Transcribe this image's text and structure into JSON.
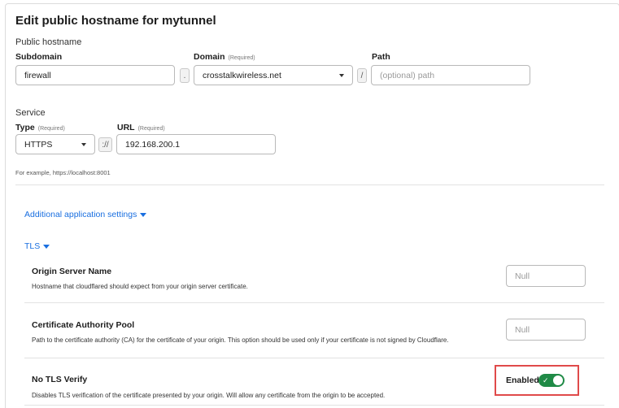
{
  "page_title": "Edit public hostname for mytunnel",
  "public_hostname": {
    "section_label": "Public hostname",
    "subdomain": {
      "label": "Subdomain",
      "value": "firewall"
    },
    "dot_separator": ".",
    "domain": {
      "label": "Domain",
      "required": "(Required)",
      "value": "crosstalkwireless.net"
    },
    "slash_separator": "/",
    "path": {
      "label": "Path",
      "placeholder": "(optional) path"
    }
  },
  "service": {
    "section_label": "Service",
    "type": {
      "label": "Type",
      "required": "(Required)",
      "value": "HTTPS"
    },
    "scheme_separator": "://",
    "url": {
      "label": "URL",
      "required": "(Required)",
      "value": "192.168.200.1"
    },
    "hint": "For example, https://localhost:8001"
  },
  "additional_settings_link": "Additional application settings",
  "tls_link": "TLS",
  "settings": {
    "origin_server_name": {
      "title": "Origin Server Name",
      "description": "Hostname that cloudflared should expect from your origin server certificate.",
      "placeholder": "Null"
    },
    "ca_pool": {
      "title": "Certificate Authority Pool",
      "description": "Path to the certificate authority (CA) for the certificate of your origin. This option should be used only if your certificate is not signed by Cloudflare.",
      "placeholder": "Null"
    },
    "no_tls_verify": {
      "title": "No TLS Verify",
      "description": "Disables TLS verification of the certificate presented by your origin. Will allow any certificate from the origin to be accepted.",
      "state_label": "Enabled",
      "enabled": true
    }
  },
  "colors": {
    "accent_link": "#1a6fe0",
    "toggle_on": "#1f8a46",
    "highlight_box": "#e04a4a"
  },
  "icons": [
    "chevron-down-icon",
    "checkmark-icon"
  ]
}
